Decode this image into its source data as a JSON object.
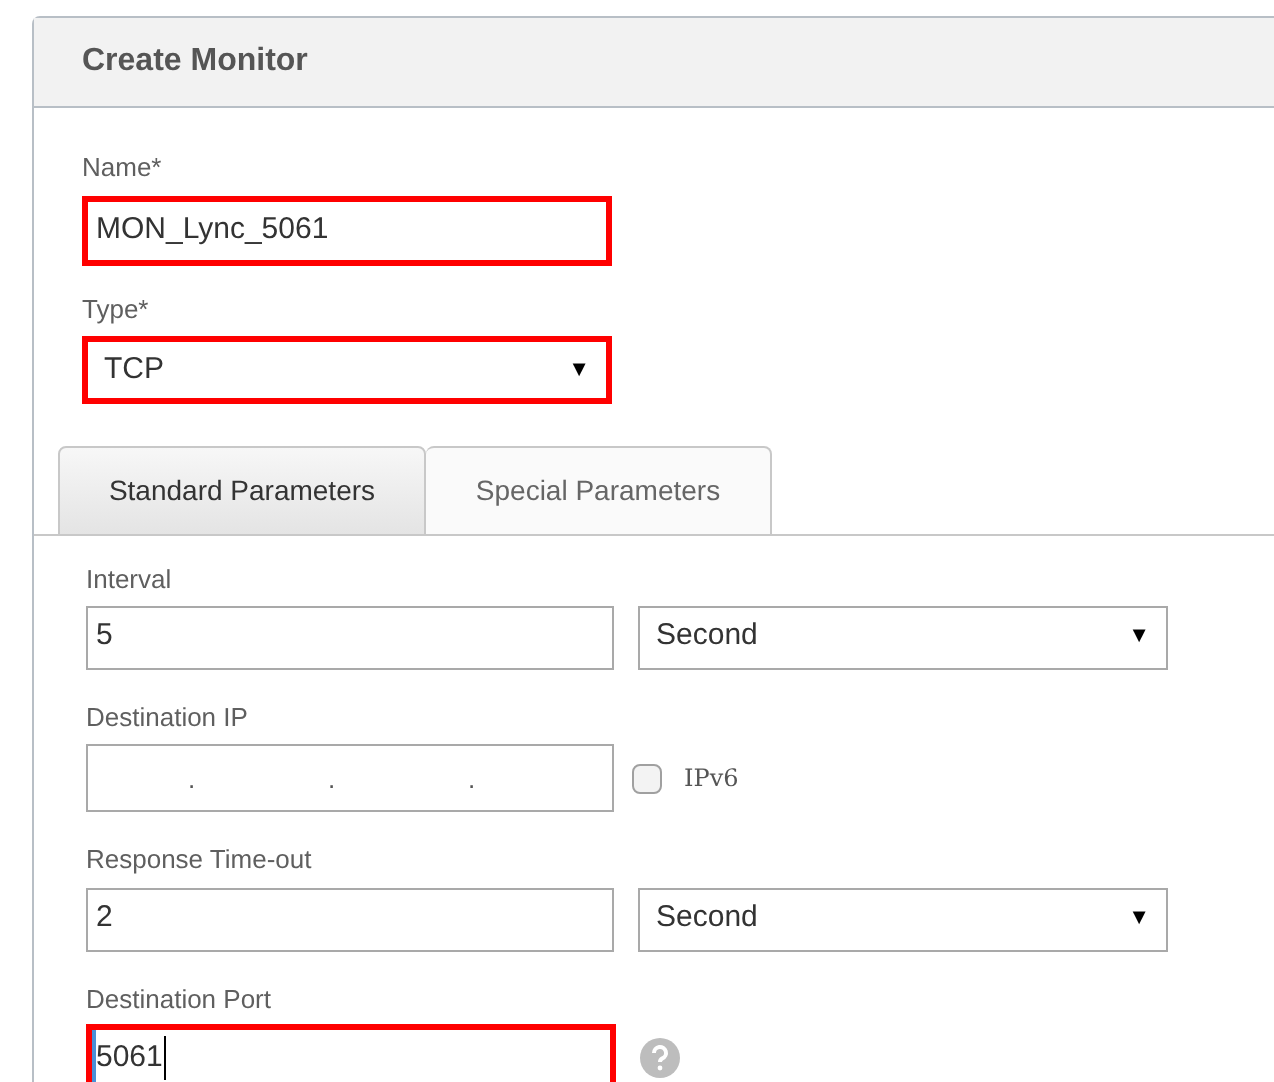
{
  "panel": {
    "title": "Create Monitor"
  },
  "name_field": {
    "label": "Name*",
    "value": "MON_Lync_5061",
    "highlighted": true
  },
  "type_field": {
    "label": "Type*",
    "value": "TCP",
    "arrow": "▼",
    "highlighted": true
  },
  "tabs": [
    {
      "label": "Standard Parameters",
      "selected": true
    },
    {
      "label": "Special Parameters",
      "selected": false
    }
  ],
  "interval": {
    "label": "Interval",
    "value": "5",
    "unit": "Second",
    "arrow": "▼"
  },
  "destination_ip": {
    "label": "Destination IP",
    "separators": [
      ".",
      ".",
      "."
    ],
    "ipv6": {
      "label": "IPv6",
      "checked": false
    }
  },
  "response_timeout": {
    "label": "Response Time-out",
    "value": "2",
    "unit": "Second",
    "arrow": "▼"
  },
  "destination_port": {
    "label": "Destination Port",
    "value": "5061",
    "highlighted": true,
    "focused": true
  }
}
